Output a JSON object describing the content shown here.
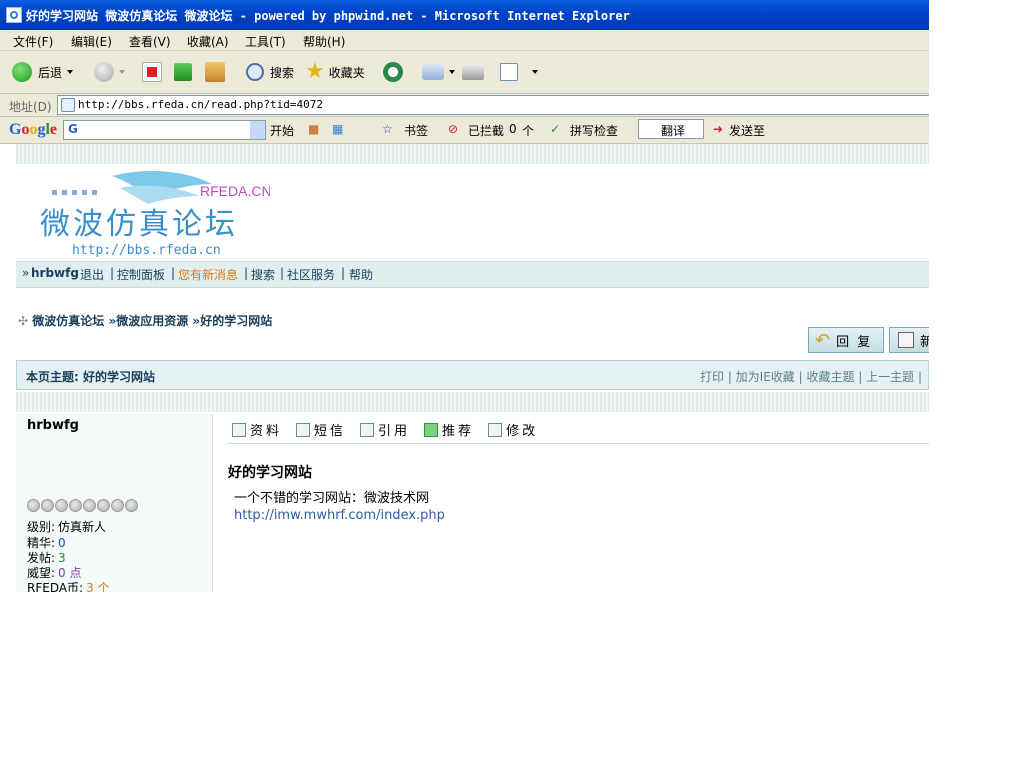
{
  "window": {
    "title": "好的学习网站 微波仿真论坛 微波论坛 - powered by phpwind.net - Microsoft Internet Explorer"
  },
  "menu": [
    "文件(F)",
    "编辑(E)",
    "查看(V)",
    "收藏(A)",
    "工具(T)",
    "帮助(H)"
  ],
  "toolbar": {
    "back": "后退",
    "search": "搜索",
    "favorites": "收藏夹"
  },
  "address": {
    "label": "地址(D)",
    "url": "http://bbs.rfeda.cn/read.php?tid=4072"
  },
  "google_bar": {
    "logo": "Google",
    "input_value": "G",
    "start": "开始",
    "bookmarks": "书签",
    "blocked": "已拦截",
    "blocked_count": "0",
    "blocked_unit": "个",
    "spellcheck": "拼写检查",
    "translate": "翻译",
    "sendto": "发送至"
  },
  "logo": {
    "brand": "RFEDA.CN",
    "name": "微波仿真论坛",
    "url": "http://bbs.rfeda.cn"
  },
  "navbar": {
    "user": "hrbwfg",
    "logout": "退出",
    "control_panel": "控制面板",
    "new_message": "您有新消息",
    "search": "搜索",
    "community": "社区服务",
    "help": "帮助"
  },
  "breadcrumb": [
    "微波仿真论坛",
    "微波应用资源",
    "好的学习网站"
  ],
  "buttons": {
    "reply": "回 复",
    "new": "新"
  },
  "topic": {
    "label": "本页主题: 好的学习网站",
    "links": "打印 | 加为IE收藏 | 收藏主题 | 上一主题 |"
  },
  "user": {
    "name": "hrbwfg",
    "stars_total": 8,
    "level_label": "级别:",
    "level": "仿真新人",
    "digest_label": "精华:",
    "digest": "0",
    "posts_label": "发帖:",
    "posts": "3",
    "prestige_label": "威望:",
    "prestige": "0 点",
    "coin_label": "RFEDA币:",
    "coin": "3 个"
  },
  "post_actions": [
    "资料",
    "短信",
    "引用",
    "推荐",
    "修改"
  ],
  "post": {
    "title": "好的学习网站",
    "text": "一个不错的学习网站：微波技术网",
    "link": "http://imw.mwhrf.com/index.php"
  },
  "colors": {
    "titlebar": "#0a5fe0",
    "nav_bg": "#e1eef0",
    "link": "#2a5f9f",
    "new_message": "#e07a12",
    "digest": "#1a4fb0",
    "posts": "#1f8a3c",
    "prestige": "#8a3ca8",
    "coin": "#e07a12"
  }
}
